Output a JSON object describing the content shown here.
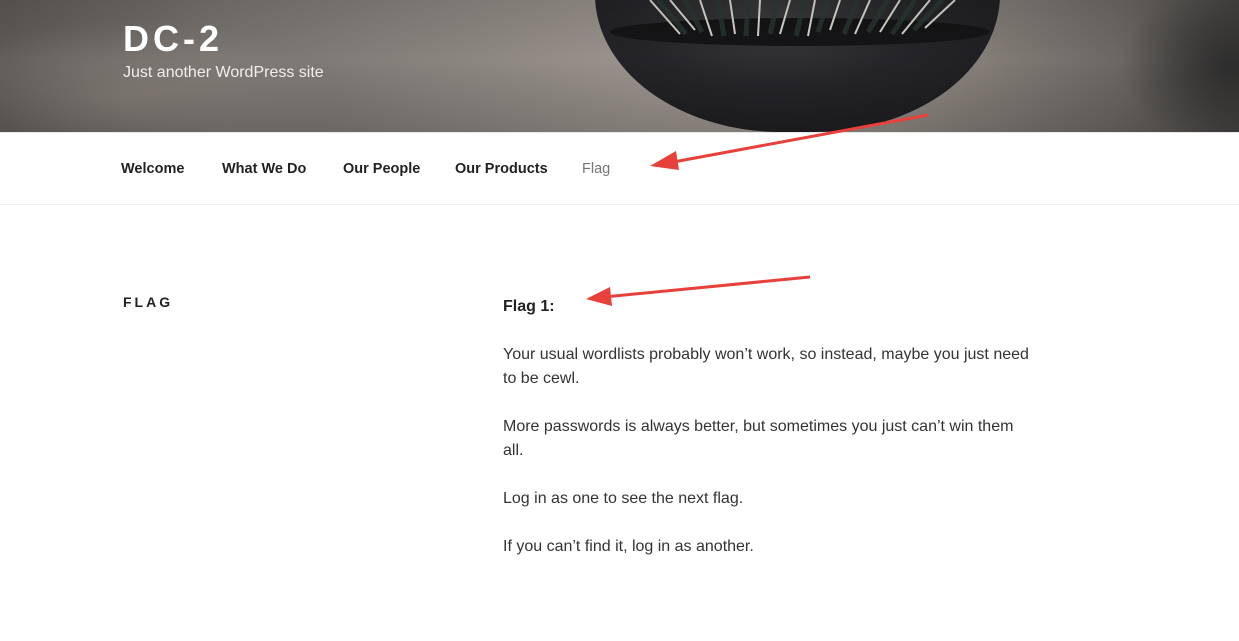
{
  "header": {
    "site_title": "DC-2",
    "site_description": "Just another WordPress site"
  },
  "nav": {
    "items": [
      {
        "label": "Welcome",
        "current": false
      },
      {
        "label": "What We Do",
        "current": false
      },
      {
        "label": "Our People",
        "current": false
      },
      {
        "label": "Our Products",
        "current": false
      },
      {
        "label": "Flag",
        "current": true
      }
    ]
  },
  "page": {
    "title": "FLAG",
    "heading": "Flag 1:",
    "paragraphs": [
      "Your usual wordlists probably won’t work, so instead, maybe you just need to be cewl.",
      "More passwords is always better, but sometimes you just can’t win them all.",
      "Log in as one to see the next flag.",
      "If you can’t find it, log in as another."
    ]
  },
  "colors": {
    "annotation_arrow": "#e8403a",
    "nav_current": "#767676",
    "text": "#222222"
  }
}
